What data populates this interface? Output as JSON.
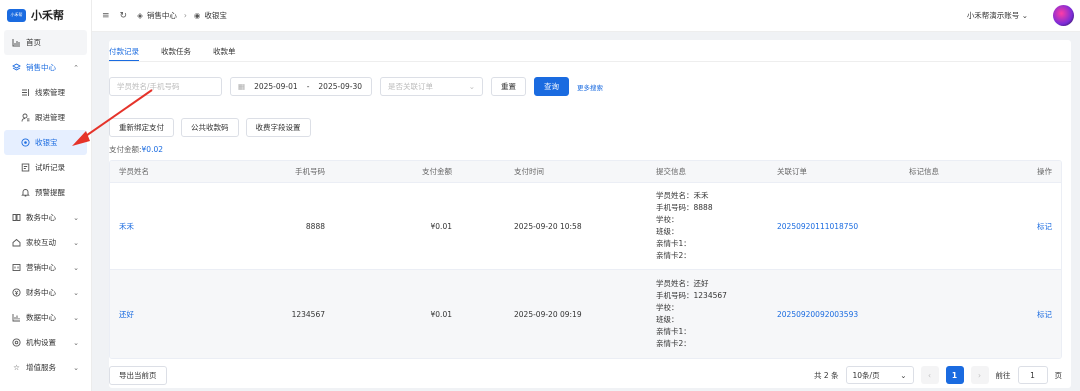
{
  "app": {
    "logo_mark": "小禾帮",
    "name": "小禾帮"
  },
  "sidebar": {
    "items": [
      {
        "label": "首页",
        "icon": "bar-chart-icon"
      },
      {
        "label": "销售中心",
        "icon": "layers-icon"
      },
      {
        "label": "线索管理",
        "icon": "clue-icon"
      },
      {
        "label": "跟进管理",
        "icon": "user-icon"
      },
      {
        "label": "收银宝",
        "icon": "cashier-icon"
      },
      {
        "label": "试听记录",
        "icon": "record-icon"
      },
      {
        "label": "预警提醒",
        "icon": "bell-icon"
      },
      {
        "label": "教务中心",
        "icon": "book-icon"
      },
      {
        "label": "家校互动",
        "icon": "home-icon"
      },
      {
        "label": "营销中心",
        "icon": "marketing-icon"
      },
      {
        "label": "财务中心",
        "icon": "finance-icon"
      },
      {
        "label": "数据中心",
        "icon": "data-icon"
      },
      {
        "label": "机构设置",
        "icon": "gear-icon"
      },
      {
        "label": "增值服务",
        "icon": "star-icon"
      }
    ]
  },
  "topbar": {
    "breadcrumb_1": "销售中心",
    "breadcrumb_2": "收银宝",
    "account": "小禾帮演示账号"
  },
  "tabs": [
    "付款记录",
    "收款任务",
    "收款单"
  ],
  "filters": {
    "name_placeholder": "学员姓名/手机号码",
    "date_start": "2025-09-01",
    "date_sep": "-",
    "date_end": "2025-09-30",
    "order_placeholder": "是否关联订单",
    "reset": "重置",
    "search": "查询",
    "more": "更多搜索"
  },
  "actions": [
    "重新绑定支付",
    "公共收款码",
    "收费字段设置"
  ],
  "total": {
    "label": "支付金额:",
    "value": "¥0.02"
  },
  "table": {
    "headers": [
      "学员姓名",
      "手机号码",
      "支付金额",
      "支付时间",
      "提交信息",
      "关联订单",
      "标记信息",
      "操作"
    ],
    "rows": [
      {
        "name": "禾禾",
        "phone": "8888",
        "amount": "¥0.01",
        "time": "2025-09-20 10:58",
        "info": [
          "学员姓名：禾禾",
          "手机号码：8888",
          "学校：",
          "班级：",
          "亲情卡1：",
          "亲情卡2："
        ],
        "order": "20250920111018750",
        "mark": "",
        "op": "标记"
      },
      {
        "name": "还好",
        "phone": "1234567",
        "amount": "¥0.01",
        "time": "2025-09-20 09:19",
        "info": [
          "学员姓名：还好",
          "手机号码：1234567",
          "学校：",
          "班级：",
          "亲情卡1：",
          "亲情卡2："
        ],
        "order": "20250920092003593",
        "mark": "",
        "op": "标记"
      }
    ]
  },
  "pager": {
    "export": "导出当前页",
    "total": "共 2 条",
    "page_size": "10条/页",
    "current": "1",
    "goto_label": "前往",
    "goto_value": "1",
    "page_suffix": "页"
  },
  "colors": {
    "accent": "#1a6be0",
    "annotation": "#e5332a"
  }
}
